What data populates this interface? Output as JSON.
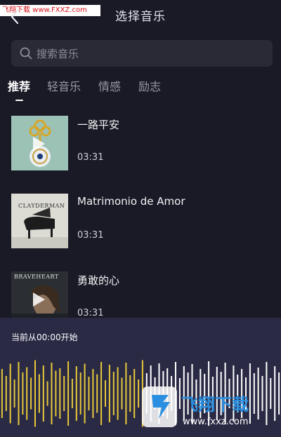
{
  "watermark_top": "飞翔下载 www.FXXZ.com",
  "header": {
    "title": "选择音乐"
  },
  "search": {
    "placeholder": "搜索音乐"
  },
  "tabs": [
    {
      "label": "推荐",
      "active": true
    },
    {
      "label": "轻音乐",
      "active": false
    },
    {
      "label": "情感",
      "active": false
    },
    {
      "label": "励志",
      "active": false
    }
  ],
  "songs": [
    {
      "title": "一路平安",
      "duration": "03:31"
    },
    {
      "title": "Matrimonio de Amor",
      "duration": "03:31",
      "cover_text": "CLAYDERMAN"
    },
    {
      "title": "勇敢的心",
      "duration": "03:31",
      "cover_text": "BRAVEHEART"
    }
  ],
  "player": {
    "status": "当前从00:00开始"
  },
  "watermark_logo": {
    "title": "飞翔下载",
    "url": "www.fxxz.com"
  },
  "colors": {
    "background": "#1a1a26",
    "panel": "#2a2a45",
    "wave_played": "#e8c93a",
    "wave_unplayed": "#ffffff"
  }
}
